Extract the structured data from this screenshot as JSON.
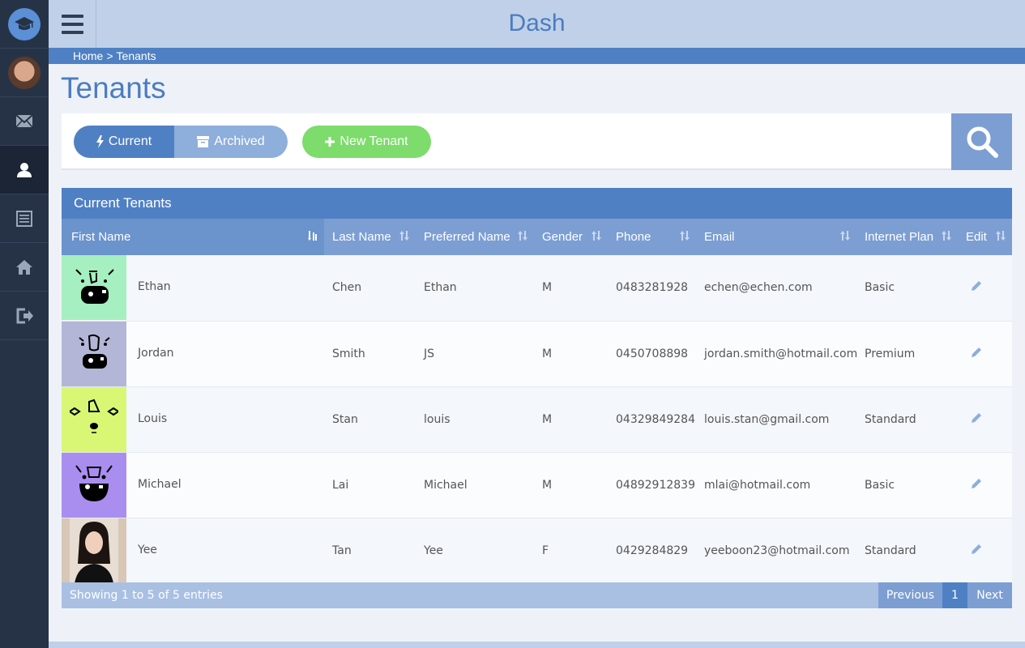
{
  "app": {
    "title": "Dash"
  },
  "breadcrumb": {
    "home": "Home",
    "sep": ">",
    "current": "Tenants"
  },
  "page": {
    "title": "Tenants"
  },
  "sidebar": {
    "items": [
      {
        "icon": "envelope-icon"
      },
      {
        "icon": "user-icon",
        "active": true
      },
      {
        "icon": "list-icon"
      },
      {
        "icon": "home-icon"
      },
      {
        "icon": "logout-icon"
      }
    ]
  },
  "toolbar": {
    "current_label": "Current",
    "archived_label": "Archived",
    "new_label": "New Tenant"
  },
  "panel": {
    "title": "Current Tenants"
  },
  "table": {
    "columns": [
      "First Name",
      "Last Name",
      "Preferred Name",
      "Gender",
      "Phone",
      "Email",
      "Internet Plan",
      "Edit"
    ],
    "rows": [
      {
        "first": "Ethan",
        "last": "Chen",
        "preferred": "Ethan",
        "gender": "M",
        "phone": "0483281928",
        "email": "echen@echen.com",
        "plan": "Basic",
        "avatar_color": "#a6efc0"
      },
      {
        "first": "Jordan",
        "last": "Smith",
        "preferred": "JS",
        "gender": "M",
        "phone": "0450708898",
        "email": "jordan.smith@hotmail.com",
        "plan": "Premium",
        "avatar_color": "#b3b6d6"
      },
      {
        "first": "Louis",
        "last": "Stan",
        "preferred": "louis",
        "gender": "M",
        "phone": "04329849284",
        "email": "louis.stan@gmail.com",
        "plan": "Standard",
        "avatar_color": "#d9f774"
      },
      {
        "first": "Michael",
        "last": "Lai",
        "preferred": "Michael",
        "gender": "M",
        "phone": "04892912839",
        "email": "mlai@hotmail.com",
        "plan": "Basic",
        "avatar_color": "#a98ef0"
      },
      {
        "first": "Yee",
        "last": "Tan",
        "preferred": "Yee",
        "gender": "F",
        "phone": "0429284829",
        "email": "yeeboon23@hotmail.com",
        "plan": "Standard",
        "avatar_color": "#d8c7b6"
      }
    ]
  },
  "footer": {
    "info": "Showing 1 to 5 of 5 entries",
    "previous": "Previous",
    "page": "1",
    "next": "Next"
  }
}
